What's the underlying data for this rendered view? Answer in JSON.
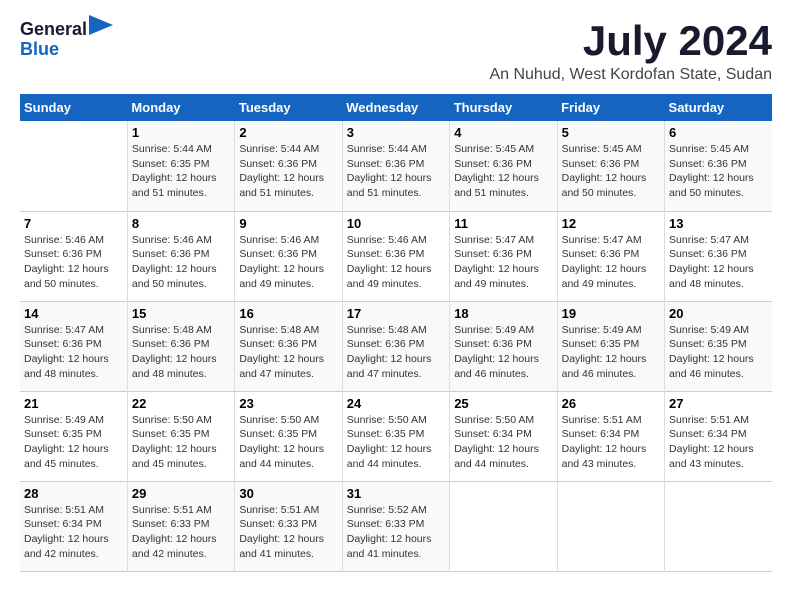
{
  "header": {
    "logo": {
      "general": "General",
      "blue": "Blue"
    },
    "title": "July 2024",
    "subtitle": "An Nuhud, West Kordofan State, Sudan"
  },
  "calendar": {
    "days_of_week": [
      "Sunday",
      "Monday",
      "Tuesday",
      "Wednesday",
      "Thursday",
      "Friday",
      "Saturday"
    ],
    "weeks": [
      [
        {
          "day": "",
          "info": ""
        },
        {
          "day": "1",
          "info": "Sunrise: 5:44 AM\nSunset: 6:35 PM\nDaylight: 12 hours\nand 51 minutes."
        },
        {
          "day": "2",
          "info": "Sunrise: 5:44 AM\nSunset: 6:36 PM\nDaylight: 12 hours\nand 51 minutes."
        },
        {
          "day": "3",
          "info": "Sunrise: 5:44 AM\nSunset: 6:36 PM\nDaylight: 12 hours\nand 51 minutes."
        },
        {
          "day": "4",
          "info": "Sunrise: 5:45 AM\nSunset: 6:36 PM\nDaylight: 12 hours\nand 51 minutes."
        },
        {
          "day": "5",
          "info": "Sunrise: 5:45 AM\nSunset: 6:36 PM\nDaylight: 12 hours\nand 50 minutes."
        },
        {
          "day": "6",
          "info": "Sunrise: 5:45 AM\nSunset: 6:36 PM\nDaylight: 12 hours\nand 50 minutes."
        }
      ],
      [
        {
          "day": "7",
          "info": "Sunrise: 5:46 AM\nSunset: 6:36 PM\nDaylight: 12 hours\nand 50 minutes."
        },
        {
          "day": "8",
          "info": "Sunrise: 5:46 AM\nSunset: 6:36 PM\nDaylight: 12 hours\nand 50 minutes."
        },
        {
          "day": "9",
          "info": "Sunrise: 5:46 AM\nSunset: 6:36 PM\nDaylight: 12 hours\nand 49 minutes."
        },
        {
          "day": "10",
          "info": "Sunrise: 5:46 AM\nSunset: 6:36 PM\nDaylight: 12 hours\nand 49 minutes."
        },
        {
          "day": "11",
          "info": "Sunrise: 5:47 AM\nSunset: 6:36 PM\nDaylight: 12 hours\nand 49 minutes."
        },
        {
          "day": "12",
          "info": "Sunrise: 5:47 AM\nSunset: 6:36 PM\nDaylight: 12 hours\nand 49 minutes."
        },
        {
          "day": "13",
          "info": "Sunrise: 5:47 AM\nSunset: 6:36 PM\nDaylight: 12 hours\nand 48 minutes."
        }
      ],
      [
        {
          "day": "14",
          "info": "Sunrise: 5:47 AM\nSunset: 6:36 PM\nDaylight: 12 hours\nand 48 minutes."
        },
        {
          "day": "15",
          "info": "Sunrise: 5:48 AM\nSunset: 6:36 PM\nDaylight: 12 hours\nand 48 minutes."
        },
        {
          "day": "16",
          "info": "Sunrise: 5:48 AM\nSunset: 6:36 PM\nDaylight: 12 hours\nand 47 minutes."
        },
        {
          "day": "17",
          "info": "Sunrise: 5:48 AM\nSunset: 6:36 PM\nDaylight: 12 hours\nand 47 minutes."
        },
        {
          "day": "18",
          "info": "Sunrise: 5:49 AM\nSunset: 6:36 PM\nDaylight: 12 hours\nand 46 minutes."
        },
        {
          "day": "19",
          "info": "Sunrise: 5:49 AM\nSunset: 6:35 PM\nDaylight: 12 hours\nand 46 minutes."
        },
        {
          "day": "20",
          "info": "Sunrise: 5:49 AM\nSunset: 6:35 PM\nDaylight: 12 hours\nand 46 minutes."
        }
      ],
      [
        {
          "day": "21",
          "info": "Sunrise: 5:49 AM\nSunset: 6:35 PM\nDaylight: 12 hours\nand 45 minutes."
        },
        {
          "day": "22",
          "info": "Sunrise: 5:50 AM\nSunset: 6:35 PM\nDaylight: 12 hours\nand 45 minutes."
        },
        {
          "day": "23",
          "info": "Sunrise: 5:50 AM\nSunset: 6:35 PM\nDaylight: 12 hours\nand 44 minutes."
        },
        {
          "day": "24",
          "info": "Sunrise: 5:50 AM\nSunset: 6:35 PM\nDaylight: 12 hours\nand 44 minutes."
        },
        {
          "day": "25",
          "info": "Sunrise: 5:50 AM\nSunset: 6:34 PM\nDaylight: 12 hours\nand 44 minutes."
        },
        {
          "day": "26",
          "info": "Sunrise: 5:51 AM\nSunset: 6:34 PM\nDaylight: 12 hours\nand 43 minutes."
        },
        {
          "day": "27",
          "info": "Sunrise: 5:51 AM\nSunset: 6:34 PM\nDaylight: 12 hours\nand 43 minutes."
        }
      ],
      [
        {
          "day": "28",
          "info": "Sunrise: 5:51 AM\nSunset: 6:34 PM\nDaylight: 12 hours\nand 42 minutes."
        },
        {
          "day": "29",
          "info": "Sunrise: 5:51 AM\nSunset: 6:33 PM\nDaylight: 12 hours\nand 42 minutes."
        },
        {
          "day": "30",
          "info": "Sunrise: 5:51 AM\nSunset: 6:33 PM\nDaylight: 12 hours\nand 41 minutes."
        },
        {
          "day": "31",
          "info": "Sunrise: 5:52 AM\nSunset: 6:33 PM\nDaylight: 12 hours\nand 41 minutes."
        },
        {
          "day": "",
          "info": ""
        },
        {
          "day": "",
          "info": ""
        },
        {
          "day": "",
          "info": ""
        }
      ]
    ]
  }
}
